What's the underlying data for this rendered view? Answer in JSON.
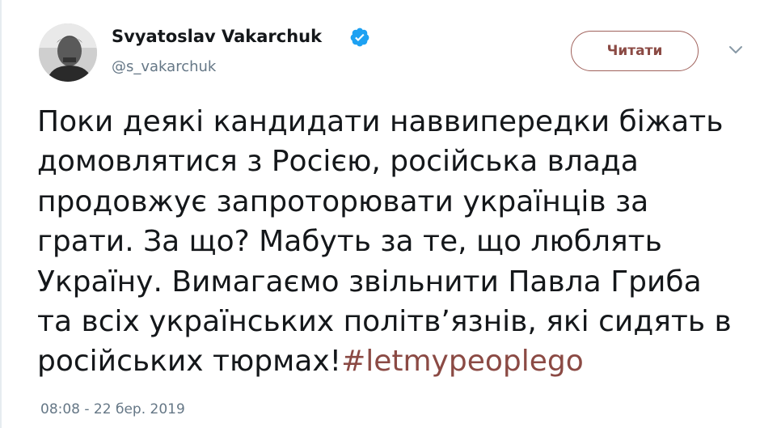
{
  "author": {
    "name": "Svyatoslav Vakarchuk",
    "handle": "@s_vakarchuk",
    "verified": true
  },
  "follow_button": {
    "label": "Читати"
  },
  "tweet": {
    "lines": [
      "Поки деякі кандидати наввипередки біжать",
      "домовлятися з Росією, російська влада",
      "продовжує запроторювати українців за",
      "грати. За що? Мабуть за те, що люблять",
      "Україну. Вимагаємо звільнити Павла Гриба",
      "та всіх українських політв’язнів, які сидять в",
      "російських тюрмах!"
    ],
    "hashtag": "#letmypeoplego",
    "timestamp": "08:08 - 22 бер. 2019"
  },
  "icons": {
    "verified": "verified-badge-icon",
    "caret": "chevron-down-icon",
    "avatar": "profile-avatar"
  },
  "colors": {
    "accent": "#8b4a44",
    "verified": "#1da1f2",
    "muted": "#657786",
    "text": "#14171a"
  }
}
